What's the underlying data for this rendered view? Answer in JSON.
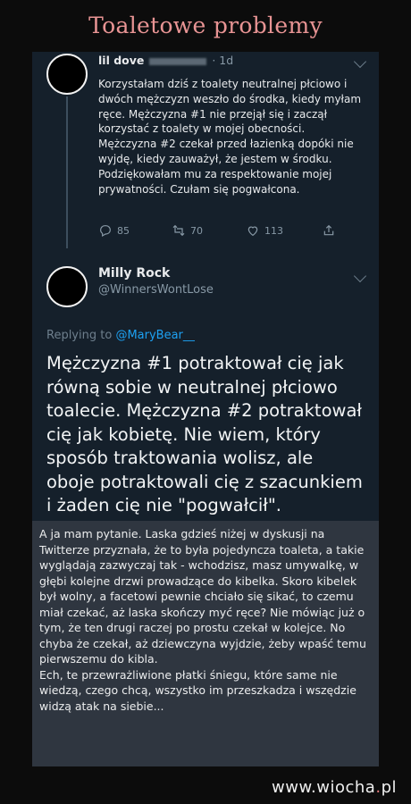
{
  "page_title": "Toaletowe problemy",
  "tweet1": {
    "author_name": "lil dove",
    "time": "· 1d",
    "text": "Korzystałam dziś z toalety neutralnej płciowo i dwóch mężczyzn weszło do środka, kiedy myłam ręce. Mężczyzna #1 nie przejął się i zaczął korzystać z toalety w mojej obecności. Mężczyzna #2 czekał przed łazienką dopóki nie wyjdę, kiedy zauważył, że jestem w środku. Podziękowałam mu za respektowanie mojej prywatności. Czułam się pogwałcona.",
    "replies": "85",
    "retweets": "70",
    "likes": "113"
  },
  "tweet2": {
    "author_name": "Milly Rock",
    "handle": "@WinnersWontLose",
    "replying_prefix": "Replying to ",
    "replying_to": "@MaryBear__",
    "text": "Mężczyzna #1 potraktował cię jak równą sobie w neutralnej płciowo toalecie. Mężczyzna #2 potraktował cię jak kobietę. Nie wiem, który sposób traktowania wolisz, ale oboje potraktowali cię z szacunkiem i żaden cię nie \"pogwałcił\"."
  },
  "comment": {
    "paragraph1": "A ja mam pytanie. Laska gdzieś niżej w dyskusji na Twitterze przyznała, że to była pojedyncza toaleta, a takie wyglądają zazwyczaj tak - wchodzisz, masz umywalkę, w głębi kolejne drzwi prowadzące do kibelka. Skoro kibelek był wolny, a facetowi pewnie chciało się sikać, to czemu miał czekać, aż laska skończy myć ręce? Nie mówiąc już o tym, że ten drugi raczej po prostu czekał w kolejce. No chyba że czekał, aż dziewczyna wyjdzie, żeby wpaść temu pierwszemu do kibla.",
    "paragraph2": "Ech, te przewrażliwione płatki śniegu, które same nie wiedzą, czego chcą, wszystko im przeszkadza i wszędzie widzą atak na siebie..."
  },
  "watermark": {
    "prefix": "www.wiocha",
    "dot": ".",
    "suffix": "pl"
  },
  "colors": {
    "title": "#e89494",
    "tweet_bg": "#15202b",
    "comment_bg": "#2f3640",
    "mention": "#1da1f2",
    "muted": "#8899a6"
  },
  "icons": [
    "reply-icon",
    "retweet-icon",
    "like-icon",
    "share-icon",
    "chevron-down-icon"
  ]
}
